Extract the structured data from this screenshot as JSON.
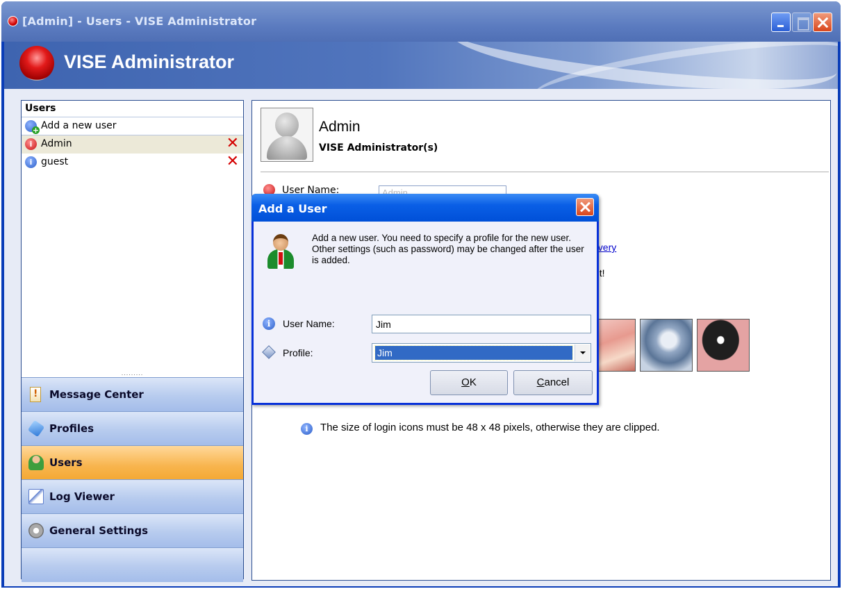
{
  "window": {
    "title": "[Admin] - Users - VISE Administrator",
    "app_name": "VISE Administrator"
  },
  "users_panel": {
    "heading": "Users",
    "add_label": "Add a new user",
    "items": [
      {
        "name": "Admin",
        "status": "red-info-icon",
        "selected": true
      },
      {
        "name": "guest",
        "status": "blue-info-icon",
        "selected": false
      }
    ],
    "splitter": "........."
  },
  "nav": [
    {
      "label": "Message Center",
      "icon": "message-icon",
      "active": false
    },
    {
      "label": "Profiles",
      "icon": "profiles-icon",
      "active": false
    },
    {
      "label": "Users",
      "icon": "users-icon",
      "active": true
    },
    {
      "label": "Log Viewer",
      "icon": "log-icon",
      "active": false
    },
    {
      "label": "General Settings",
      "icon": "gear-icon",
      "active": false
    }
  ],
  "detail": {
    "user_name": "Admin",
    "user_profile": "VISE Administrator(s)",
    "username_field_label": "User Name:",
    "username_field_value": "Admin",
    "link_fragment": "overy",
    "text_fragment": "nt!",
    "info_text": "The size of login icons must be 48 x 48 pixels, otherwise they are clipped."
  },
  "dialog": {
    "title": "Add a User",
    "description": "Add a new user. You need to specify a profile for the new user. Other settings (such as password) may be changed after the user is added.",
    "user_name_label": "User Name:",
    "user_name_value": "Jim",
    "profile_label": "Profile:",
    "profile_value": "Jim",
    "ok": "OK",
    "cancel": "Cancel"
  },
  "colors": {
    "accent_blue": "#0831d9",
    "active_nav": "#f8b54e",
    "nav_bg": "#b7cbee",
    "delete_red": "#d40000"
  }
}
